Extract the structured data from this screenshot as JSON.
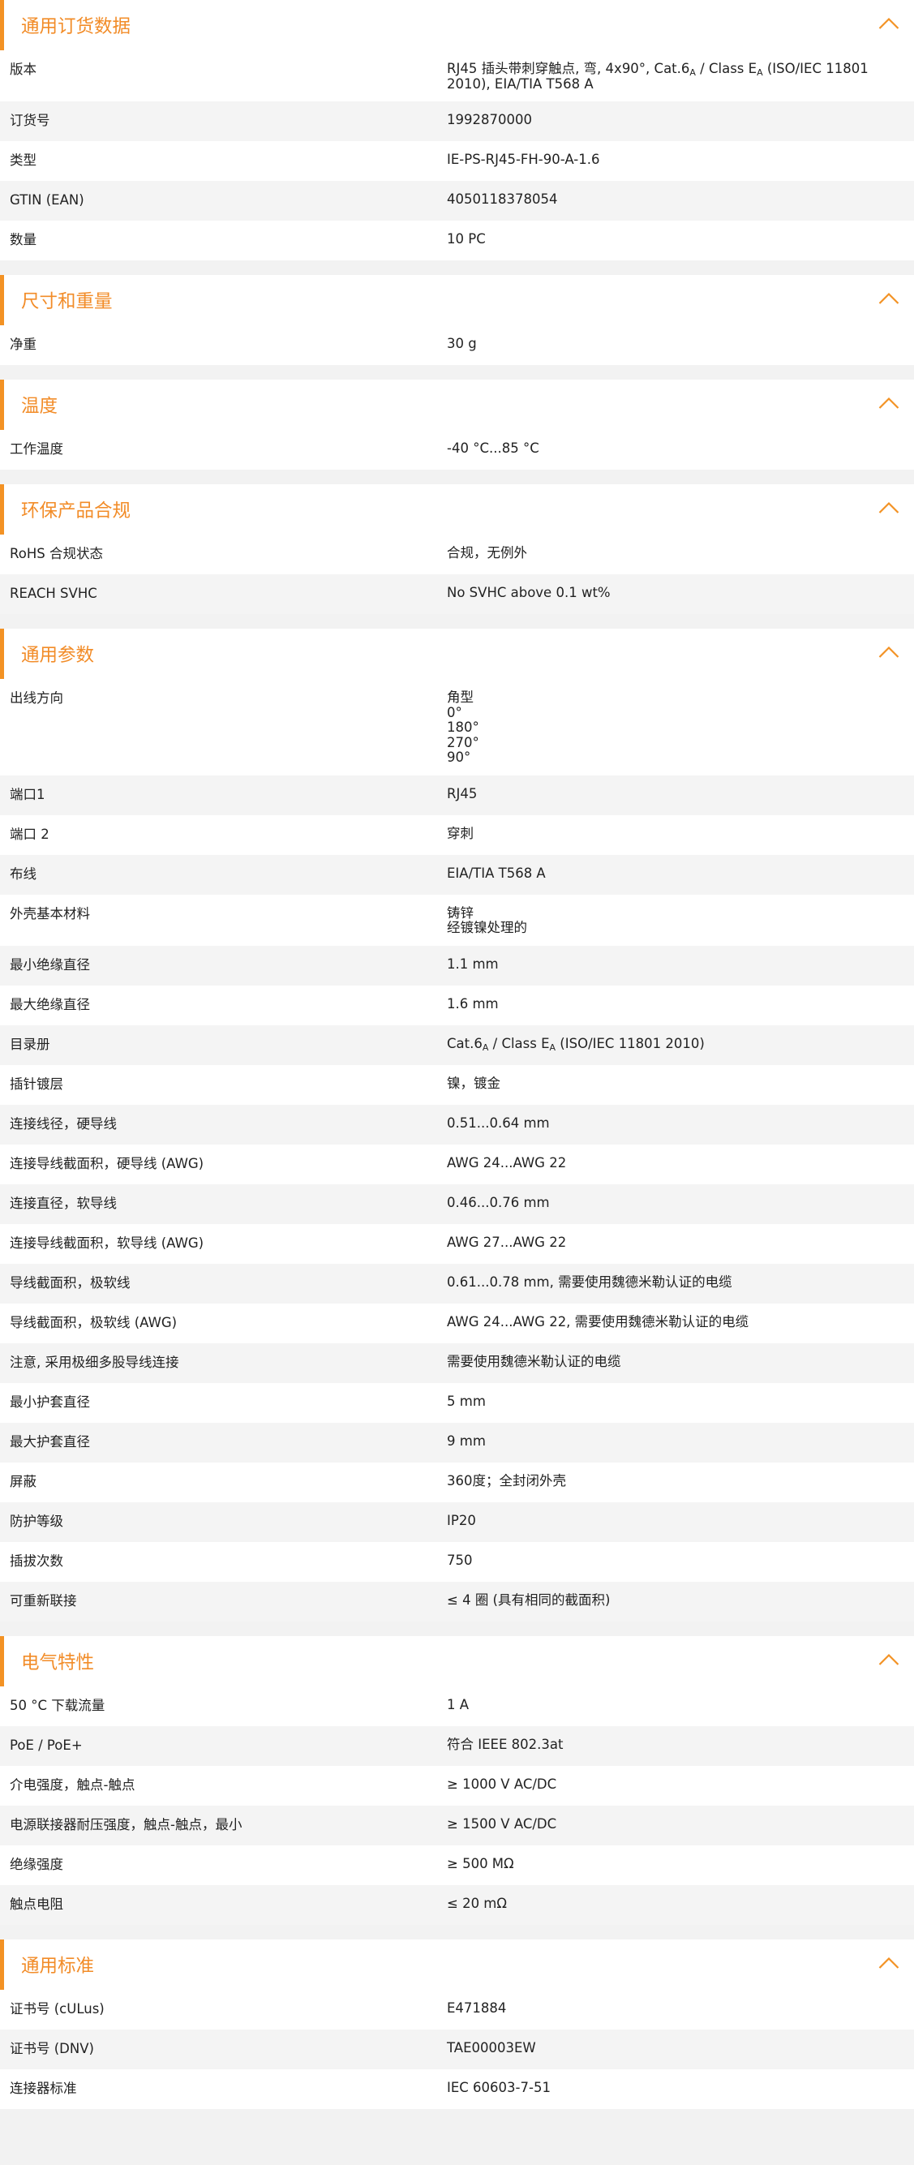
{
  "accent_color": "#f39224",
  "chevron_icon": "chevron-up-icon",
  "sections": [
    {
      "title": "通用订货数据",
      "rows": [
        {
          "label": "版本",
          "value_html": "RJ45 插头带刺穿触点, 弯, 4x90°, Cat.6<sub>A</sub> / Class E<sub>A</sub> (ISO/IEC 11801<br>2010), EIA/TIA T568 A"
        },
        {
          "label": "订货号",
          "value": "1992870000"
        },
        {
          "label": "类型",
          "value": "IE-PS-RJ45-FH-90-A-1.6"
        },
        {
          "label": "GTIN (EAN)",
          "value": "4050118378054"
        },
        {
          "label": "数量",
          "value": "10  PC"
        }
      ]
    },
    {
      "title": "尺寸和重量",
      "rows": [
        {
          "label": "净重",
          "value": "30  g"
        }
      ]
    },
    {
      "title": "温度",
      "rows": [
        {
          "label": "工作温度",
          "value": "-40 °C...85 °C"
        }
      ]
    },
    {
      "title": "环保产品合规",
      "rows": [
        {
          "label": "RoHS 合规状态",
          "value": "合规，无例外"
        },
        {
          "label": "REACH SVHC",
          "value": "No SVHC above 0.1 wt%"
        }
      ]
    },
    {
      "title": "通用参数",
      "rows": [
        {
          "label": "出线方向",
          "values": [
            "角型",
            "0°",
            "180°",
            "270°",
            "90°"
          ]
        },
        {
          "label": "端口1",
          "value": "RJ45"
        },
        {
          "label": "端口 2",
          "value": "穿刺"
        },
        {
          "label": "布线",
          "value": "EIA/TIA T568 A"
        },
        {
          "label": "外壳基本材料",
          "values": [
            "铸锌",
            "经镀镍处理的"
          ]
        },
        {
          "label": "最小绝缘直径",
          "value": "1.1  mm"
        },
        {
          "label": "最大绝缘直径",
          "value": "1.6  mm"
        },
        {
          "label": "目录册",
          "value_html": "Cat.6<sub>A</sub> / Class E<sub>A</sub> (ISO/IEC 11801 2010)"
        },
        {
          "label": "插针镀层",
          "value": "镍，镀金"
        },
        {
          "label": "连接线径，硬导线",
          "value": "0.51...0.64 mm"
        },
        {
          "label": "连接导线截面积，硬导线 (AWG)",
          "value": "AWG 24...AWG 22"
        },
        {
          "label": "连接直径，软导线",
          "value": "0.46...0.76 mm"
        },
        {
          "label": "连接导线截面积，软导线 (AWG)",
          "value": "AWG 27...AWG 22"
        },
        {
          "label": "导线截面积，极软线",
          "value": "0.61...0.78 mm, 需要使用魏德米勒认证的电缆"
        },
        {
          "label": "导线截面积，极软线 (AWG)",
          "value": "AWG 24...AWG 22, 需要使用魏德米勒认证的电缆"
        },
        {
          "label": "注意, 采用极细多股导线连接",
          "value": "需要使用魏德米勒认证的电缆"
        },
        {
          "label": "最小护套直径",
          "value": "5  mm"
        },
        {
          "label": "最大护套直径",
          "value": "9  mm"
        },
        {
          "label": "屏蔽",
          "value": "360度；全封闭外壳"
        },
        {
          "label": "防护等级",
          "value": "IP20"
        },
        {
          "label": "插拔次数",
          "value": "750"
        },
        {
          "label": "可重新联接",
          "value": "≤ 4 圈 (具有相同的截面积)"
        }
      ]
    },
    {
      "title": "电气特性",
      "rows": [
        {
          "label": "50 °C 下载流量",
          "value": "1  A"
        },
        {
          "label": "PoE / PoE+",
          "value": "符合 IEEE 802.3at"
        },
        {
          "label": "介电强度，触点-触点",
          "value": "≥ 1000 V AC/DC"
        },
        {
          "label": "电源联接器耐压强度，触点-触点，最小",
          "value": "≥ 1500 V AC/DC"
        },
        {
          "label": "绝缘强度",
          "value": "≥ 500 MΩ"
        },
        {
          "label": "触点电阻",
          "value": "≤ 20 mΩ"
        }
      ]
    },
    {
      "title": "通用标准",
      "rows": [
        {
          "label": "证书号 (cULus)",
          "value": "E471884"
        },
        {
          "label": "证书号 (DNV)",
          "value": "TAE00003EW"
        },
        {
          "label": "连接器标准",
          "value": "IEC 60603-7-51"
        }
      ]
    }
  ]
}
